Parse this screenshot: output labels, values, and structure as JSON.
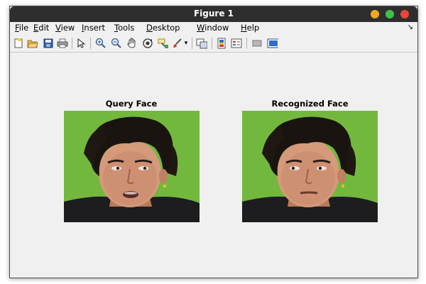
{
  "window": {
    "title": "Figure 1"
  },
  "menu": {
    "items": [
      {
        "label": "File"
      },
      {
        "label": "Edit"
      },
      {
        "label": "View"
      },
      {
        "label": "Insert"
      },
      {
        "label": "Tools"
      },
      {
        "label": "Desktop"
      },
      {
        "label": "Window"
      },
      {
        "label": "Help"
      }
    ]
  },
  "toolbar": {
    "icons": [
      "new-figure-icon",
      "open-file-icon",
      "save-icon",
      "print-icon",
      "pointer-icon",
      "zoom-in-icon",
      "zoom-out-icon",
      "pan-icon",
      "rotate-3d-icon",
      "data-cursor-icon",
      "brush-icon",
      "link-plot-icon",
      "colorbar-icon",
      "legend-icon",
      "hide-plot-tools-icon",
      "show-plot-tools-icon"
    ]
  },
  "axes": [
    {
      "title": "Query Face"
    },
    {
      "title": "Recognized Face"
    }
  ],
  "colors": {
    "titlebar": "#2e2e2e",
    "minimize": "#f5a623",
    "maximize": "#3fc14a",
    "close": "#e9453a",
    "background_green": "#6db33a"
  }
}
